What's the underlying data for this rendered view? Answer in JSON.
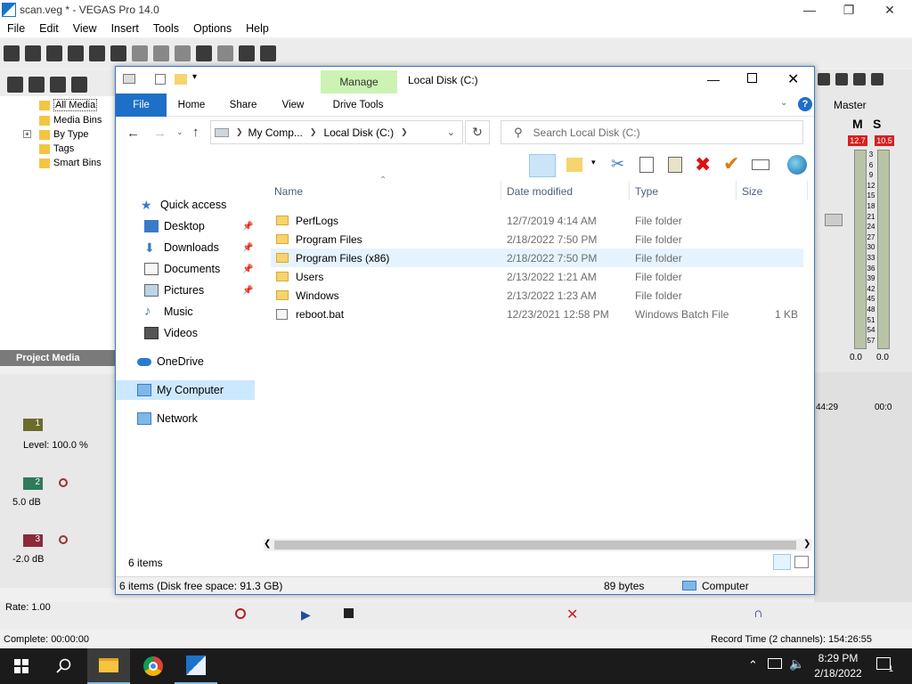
{
  "vegas": {
    "title": "scan.veg * - VEGAS Pro 14.0",
    "menu": [
      "File",
      "Edit",
      "View",
      "Insert",
      "Tools",
      "Options",
      "Help"
    ],
    "tree": [
      "All Media",
      "Media Bins",
      "By Type",
      "Tags",
      "Smart Bins"
    ],
    "project_media_tab": "Project Media",
    "track1_level": "Level: 100.0 %",
    "track2_db": "5.0 dB",
    "track3_db": "-2.0 dB",
    "track_nums": [
      "1",
      "2",
      "3"
    ],
    "master_label": "Master",
    "meter_peak_left": "12.7",
    "meter_peak_right": "10.5",
    "meter_scale": [
      "3",
      "6",
      "9",
      "12",
      "15",
      "18",
      "21",
      "24",
      "27",
      "30",
      "33",
      "36",
      "39",
      "42",
      "45",
      "48",
      "51",
      "54",
      "57"
    ],
    "meter_bottom_left": "0.0",
    "meter_bottom_right": "0.0",
    "timecode_a": "44:29",
    "timecode_b": "00:0",
    "rate": "Rate: 1.00",
    "complete": "Complete: 00:00:00",
    "record_time": "Record Time (2 channels): 154:26:55",
    "ms_labels": [
      "M",
      "S"
    ]
  },
  "explorer": {
    "manage_tab": "Manage",
    "window_title": "Local Disk (C:)",
    "ribbon_tabs": [
      "File",
      "Home",
      "Share",
      "View",
      "Drive Tools"
    ],
    "breadcrumb": [
      "My Comp...",
      "Local Disk (C:)"
    ],
    "search_placeholder": "Search Local Disk (C:)",
    "columns": [
      "Name",
      "Date modified",
      "Type",
      "Size"
    ],
    "nav": {
      "quick_access": "Quick access",
      "desktop": "Desktop",
      "downloads": "Downloads",
      "documents": "Documents",
      "pictures": "Pictures",
      "music": "Music",
      "videos": "Videos",
      "onedrive": "OneDrive",
      "my_computer": "My Computer",
      "network": "Network"
    },
    "files": [
      {
        "name": "PerfLogs",
        "date": "12/7/2019 4:14 AM",
        "type": "File folder",
        "size": "",
        "kind": "folder"
      },
      {
        "name": "Program Files",
        "date": "2/18/2022 7:50 PM",
        "type": "File folder",
        "size": "",
        "kind": "folder"
      },
      {
        "name": "Program Files (x86)",
        "date": "2/18/2022 7:50 PM",
        "type": "File folder",
        "size": "",
        "kind": "folder"
      },
      {
        "name": "Users",
        "date": "2/13/2022 1:21 AM",
        "type": "File folder",
        "size": "",
        "kind": "folder"
      },
      {
        "name": "Windows",
        "date": "2/13/2022 1:23 AM",
        "type": "File folder",
        "size": "",
        "kind": "folder"
      },
      {
        "name": "reboot.bat",
        "date": "12/23/2021 12:58 PM",
        "type": "Windows Batch File",
        "size": "1 KB",
        "kind": "bat"
      }
    ],
    "item_count": "6 items",
    "status_left": "6 items (Disk free space: 91.3 GB)",
    "status_mid": "89 bytes",
    "status_right": "Computer"
  },
  "taskbar": {
    "time": "8:29 PM",
    "date": "2/18/2022",
    "notif_count": "1"
  }
}
